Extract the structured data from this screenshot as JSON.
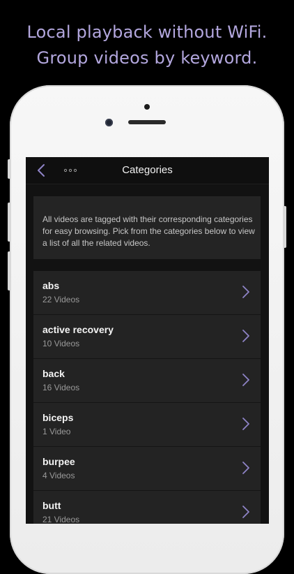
{
  "headline": {
    "line1": "Local playback without WiFi.",
    "line2": "Group videos by keyword."
  },
  "colors": {
    "headline": "#b3a7de",
    "accent": "#8f84c7",
    "background": "#000000",
    "screen": "#121212"
  },
  "navbar": {
    "title": "Categories",
    "back_icon": "chevron-left-icon",
    "more_icon": "ellipsis-icon"
  },
  "info": {
    "text": "All videos are tagged with their corresponding categories for easy browsing. Pick from the categories below to view a list of all the related videos."
  },
  "categories": [
    {
      "name": "abs",
      "count": "22 Videos"
    },
    {
      "name": "active recovery",
      "count": "10 Videos"
    },
    {
      "name": "back",
      "count": "16 Videos"
    },
    {
      "name": "biceps",
      "count": "1 Video"
    },
    {
      "name": "burpee",
      "count": "4 Videos"
    },
    {
      "name": "butt",
      "count": "21 Videos"
    }
  ]
}
